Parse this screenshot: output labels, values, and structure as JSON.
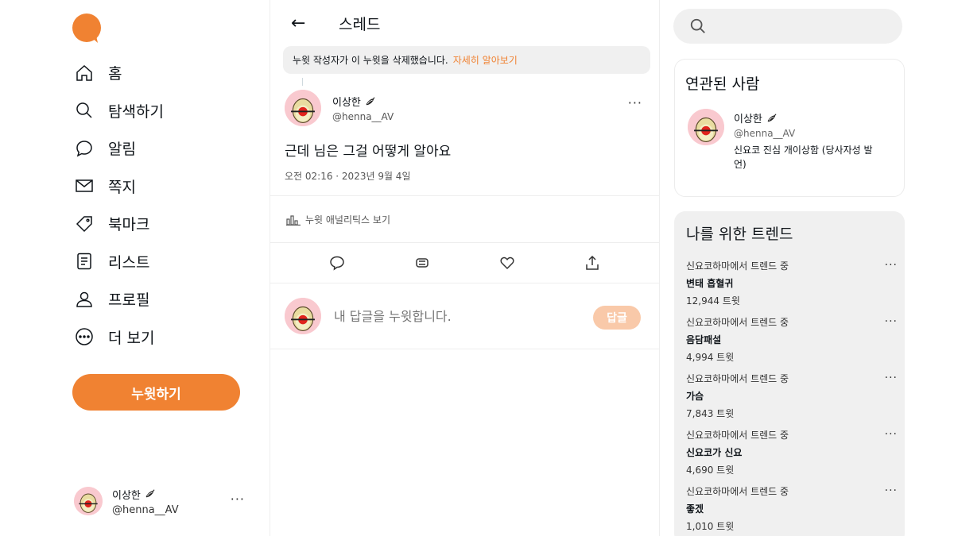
{
  "sidebar": {
    "logo_icon": "speech-bubble-logo",
    "brand_color": "#f08232",
    "nav": [
      {
        "label": "홈",
        "icon": "home-icon"
      },
      {
        "label": "탐색하기",
        "icon": "search-icon"
      },
      {
        "label": "알림",
        "icon": "bubble-icon"
      },
      {
        "label": "쪽지",
        "icon": "envelope-icon"
      },
      {
        "label": "북마크",
        "icon": "tag-icon"
      },
      {
        "label": "리스트",
        "icon": "list-icon"
      },
      {
        "label": "프로필",
        "icon": "person-icon"
      },
      {
        "label": "더 보기",
        "icon": "more-circle-icon"
      }
    ],
    "tweet_button": "누윗하기",
    "account": {
      "display_name": "이상한",
      "handle": "@henna__AV",
      "more": "···"
    }
  },
  "thread": {
    "back": "←",
    "title": "스레드",
    "notice": {
      "text": "누윗 작성자가 이 누윗을 삭제했습니다.",
      "link": "자세히 알아보기"
    },
    "post": {
      "display_name": "이상한",
      "handle": "@henna__AV",
      "more": "···",
      "text": "근데 님은 그걸 어떻게 알아요",
      "meta": "오전 02:16 · 2023년 9월 4일"
    },
    "analytics": "누윗 애널리틱스 보기",
    "actions": [
      "reply-icon",
      "renote-icon",
      "heart-icon",
      "share-icon"
    ],
    "reply": {
      "placeholder": "내 답글을 누윗합니다.",
      "button": "답글"
    }
  },
  "right": {
    "search_placeholder": "",
    "related": {
      "title": "연관된 사람",
      "display_name": "이상한",
      "handle": "@henna__AV",
      "bio": "신요코 진심 개이상함 (당사자성 발언)"
    },
    "trends": {
      "title": "나를 위한 트렌드",
      "more": "···",
      "items": [
        {
          "context": "신요코하마에서 트렌드 중",
          "name": "변태 흡혈귀",
          "count": "12,944 트윗"
        },
        {
          "context": "신요코하마에서 트렌드 중",
          "name": "음담패설",
          "count": "4,994 트윗"
        },
        {
          "context": "신요코하마에서 트렌드 중",
          "name": "가슴",
          "count": "7,843 트윗"
        },
        {
          "context": "신요코하마에서 트렌드 중",
          "name": "신요코가 신요",
          "count": "4,690 트윗"
        },
        {
          "context": "신요코하마에서 트렌드 중",
          "name": "좋겠",
          "count": "1,010 트윗"
        }
      ]
    }
  }
}
